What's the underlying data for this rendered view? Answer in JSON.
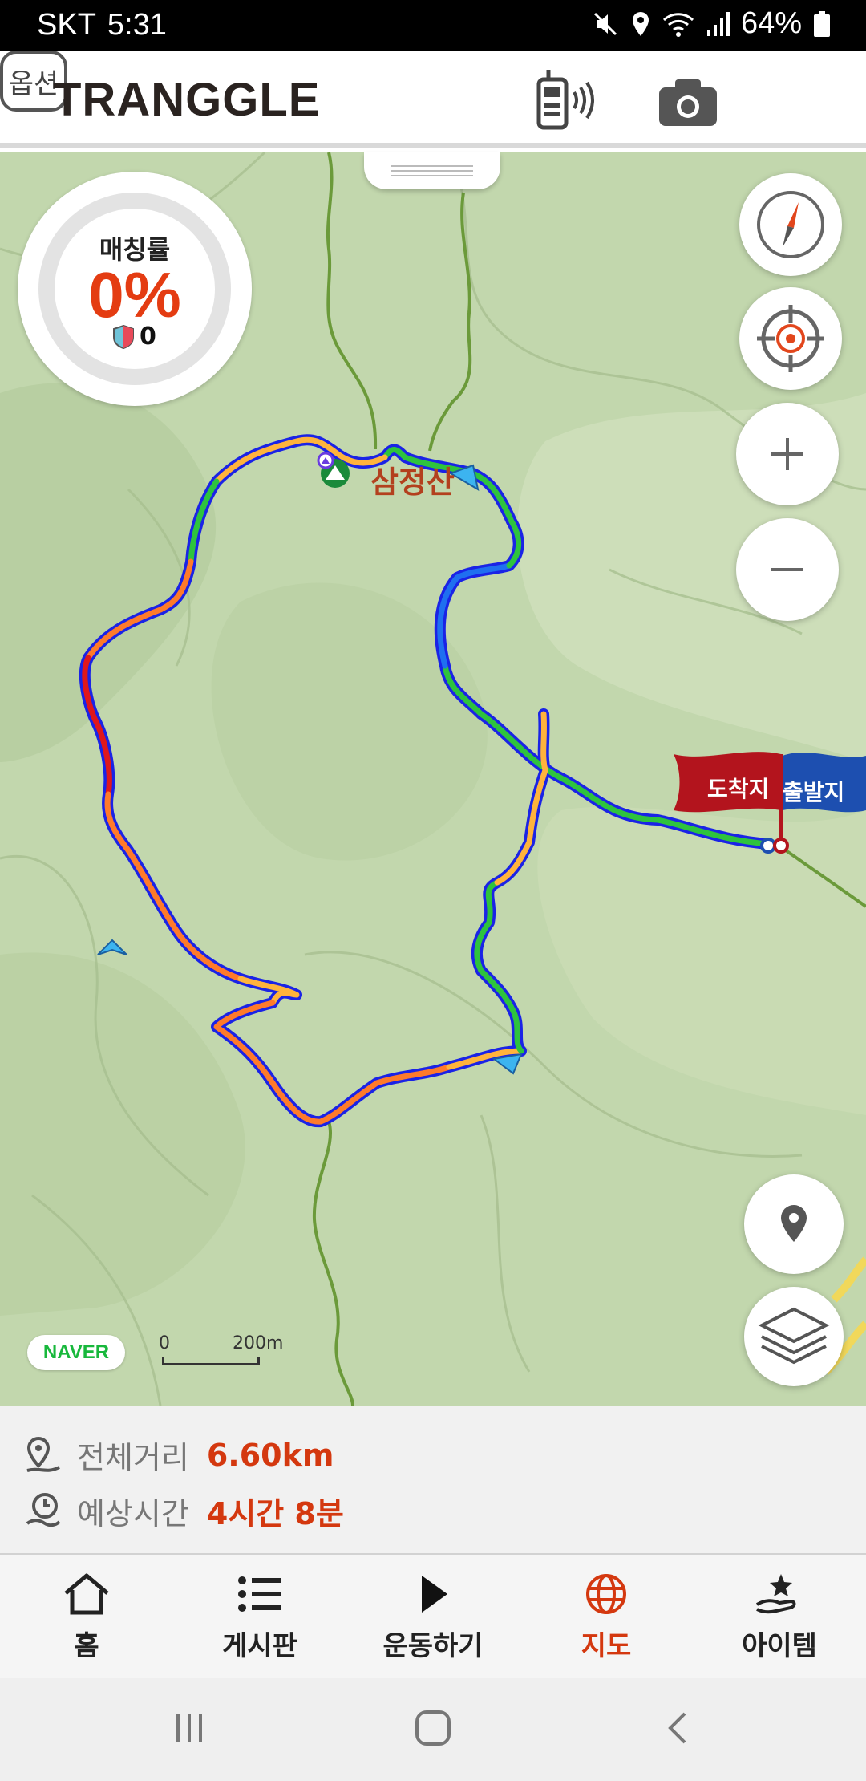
{
  "status_bar": {
    "carrier": "SKT",
    "time": "5:31",
    "battery": "64%"
  },
  "header": {
    "logo": "TRANGGLE",
    "option_label": "옵션"
  },
  "map": {
    "peak_name": "삼정산",
    "arrival_flag": "도착지",
    "start_flag": "출발지",
    "map_provider": "NAVER",
    "scale_zero": "0",
    "scale_distance": "200m"
  },
  "match": {
    "label": "매칭률",
    "value": "0%",
    "count": "0"
  },
  "info": {
    "distance_label": "전체거리",
    "distance_value": "6.60km",
    "time_label": "예상시간",
    "time_value": "4시간 8분"
  },
  "nav": {
    "items": [
      {
        "label": "홈",
        "icon": "home-icon"
      },
      {
        "label": "게시판",
        "icon": "list-icon"
      },
      {
        "label": "운동하기",
        "icon": "play-icon"
      },
      {
        "label": "지도",
        "icon": "globe-icon"
      },
      {
        "label": "아이템",
        "icon": "item-hand-icon"
      }
    ],
    "active_index": 3
  },
  "colors": {
    "accent": "#d4380f",
    "map_bg": "#c5d9b0",
    "route_outline": "#1a23e6"
  }
}
